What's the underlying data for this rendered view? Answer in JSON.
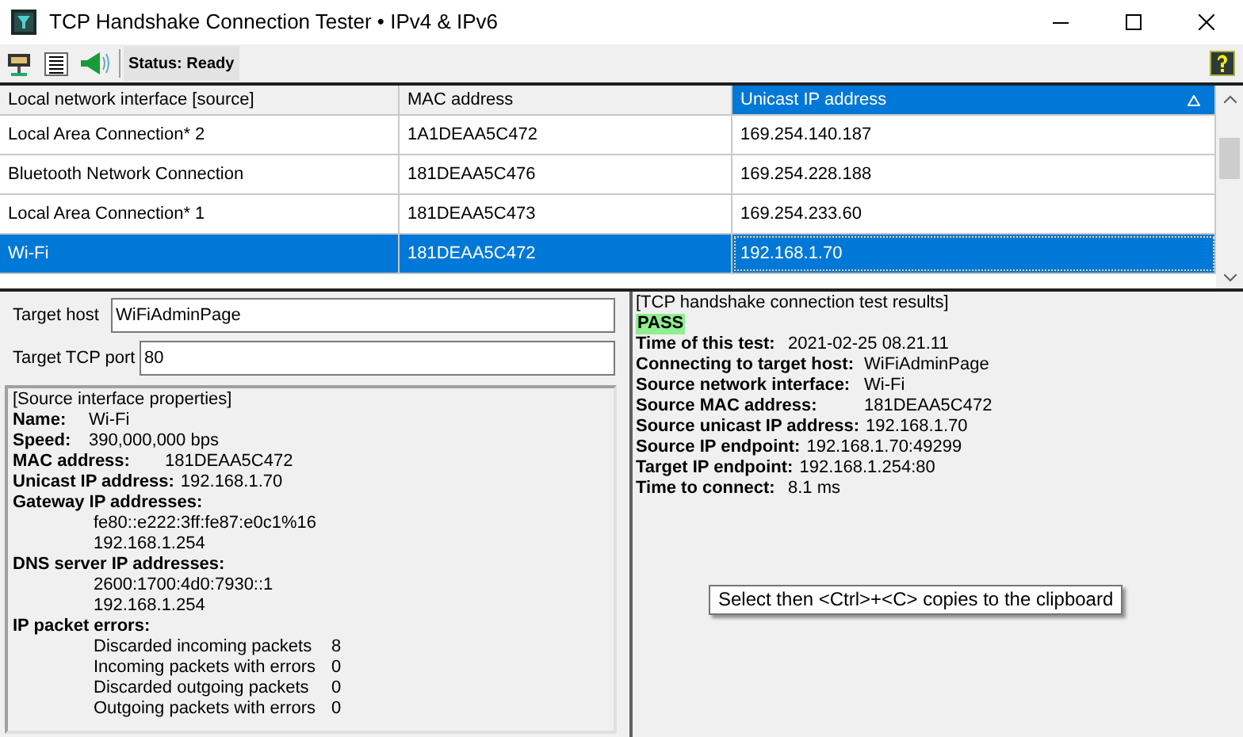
{
  "window": {
    "title": "TCP Handshake Connection Tester • IPv4 & IPv6"
  },
  "toolbar": {
    "status": "Status: Ready"
  },
  "table": {
    "columns": [
      {
        "label": "Local network interface [source]",
        "sorted": false
      },
      {
        "label": "MAC address",
        "sorted": false
      },
      {
        "label": "Unicast IP address",
        "sorted": true
      }
    ],
    "rows": [
      {
        "cells": [
          "Local Area Connection* 2",
          "1A1DEAA5C472",
          "169.254.140.187"
        ],
        "selected": false
      },
      {
        "cells": [
          "Bluetooth Network Connection",
          "181DEAA5C476",
          "169.254.228.188"
        ],
        "selected": false
      },
      {
        "cells": [
          "Local Area Connection* 1",
          "181DEAA5C473",
          "169.254.233.60"
        ],
        "selected": false
      },
      {
        "cells": [
          "Wi-Fi",
          "181DEAA5C472",
          "192.168.1.70"
        ],
        "selected": true
      }
    ]
  },
  "target": {
    "host_label": "Target host",
    "host": "WiFiAdminPage",
    "port_label": "Target TCP port",
    "port": "80"
  },
  "source_properties": {
    "heading": "[Source interface properties]",
    "lines": [
      {
        "kind": "pair",
        "label": "Name:",
        "value": "Wi-Fi"
      },
      {
        "kind": "pair",
        "label": "Speed:",
        "value": "390,000,000 bps"
      },
      {
        "kind": "pair_wide",
        "label": "MAC address:",
        "value": "181DEAA5C472"
      },
      {
        "kind": "pair_wide",
        "label": "Unicast IP address:",
        "value": "192.168.1.70"
      },
      {
        "kind": "heading",
        "label": "Gateway IP addresses:"
      },
      {
        "kind": "indented",
        "value": "fe80::e222:3ff:fe87:e0c1%16"
      },
      {
        "kind": "indented",
        "value": "192.168.1.254"
      },
      {
        "kind": "heading",
        "label": "DNS server IP addresses:"
      },
      {
        "kind": "indented",
        "value": "2600:1700:4d0:7930::1"
      },
      {
        "kind": "indented",
        "value": "192.168.1.254"
      },
      {
        "kind": "heading",
        "label": "IP packet errors:"
      },
      {
        "kind": "counter",
        "label": "Discarded incoming packets",
        "value": "8"
      },
      {
        "kind": "counter",
        "label": "Incoming packets with errors",
        "value": "0"
      },
      {
        "kind": "counter",
        "label": "Discarded outgoing packets",
        "value": "0"
      },
      {
        "kind": "counter",
        "label": "Outgoing packets with errors",
        "value": "0"
      }
    ]
  },
  "results": {
    "heading": "[TCP handshake connection test results]",
    "status": "PASS",
    "lines": [
      {
        "kind": "pair",
        "label": "Time of this test:",
        "value": "2021-02-25 08.21.11"
      },
      {
        "kind": "pair_wide",
        "label": "Connecting to target host:",
        "value": "WiFiAdminPage"
      },
      {
        "kind": "pair_wide",
        "label": "Source network interface:",
        "value": "Wi-Fi"
      },
      {
        "kind": "pair_wide",
        "label": "Source MAC address:",
        "value": "181DEAA5C472"
      },
      {
        "kind": "pair_wide",
        "label": "Source unicast IP address:",
        "value": "192.168.1.70"
      },
      {
        "kind": "pair",
        "label": "Source IP endpoint:",
        "value": "192.168.1.70:49299"
      },
      {
        "kind": "pair",
        "label": "Target IP endpoint:",
        "value": "192.168.1.254:80"
      },
      {
        "kind": "pair",
        "label": "Time to connect:",
        "value": "8.1 ms"
      }
    ]
  },
  "tooltip": "Select then <Ctrl>+<C>  copies to the clipboard"
}
